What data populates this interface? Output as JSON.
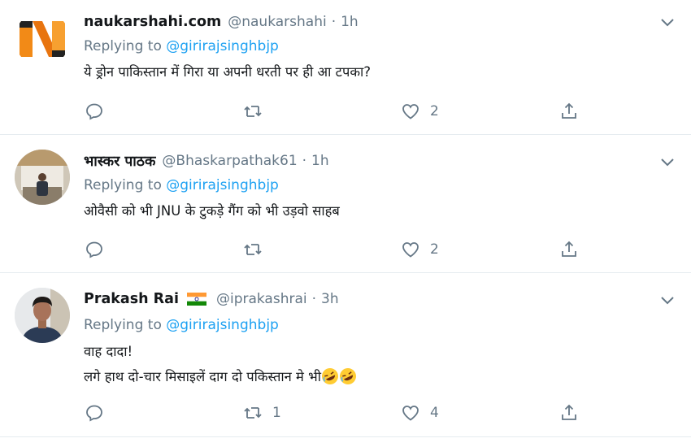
{
  "colors": {
    "link": "#1da1f2",
    "muted": "#657786",
    "text": "#14171a",
    "divider": "#e6ecf0"
  },
  "tweets": [
    {
      "name": "naukarshahi.com",
      "handle": "@naukarshahi",
      "separator": "·",
      "time": "1h",
      "replying_prefix": "Replying to",
      "replying_to": "@girirajsinghbjp",
      "lines": [
        "ये ड्रोन पाकिस्तान में गिरा या अपनी धरती पर ही आ टपका?"
      ],
      "reply_count": "",
      "retweet_count": "",
      "like_count": "2",
      "avatar": "naukarshahi-logo"
    },
    {
      "name": "भास्कर पाठक",
      "handle": "@Bhaskarpathak61",
      "separator": "·",
      "time": "1h",
      "replying_prefix": "Replying to",
      "replying_to": "@girirajsinghbjp",
      "lines": [
        "ओवैसी को भी JNU के टुकड़े गैंग को भी उड़वो साहब"
      ],
      "reply_count": "",
      "retweet_count": "",
      "like_count": "2",
      "avatar": "person-photo"
    },
    {
      "name": "Prakash Rai",
      "handle": "@iprakashrai",
      "separator": "·",
      "time": "3h",
      "replying_prefix": "Replying to",
      "replying_to": "@girirajsinghbjp",
      "lines": [
        "वाह दादा!",
        "लगे हाथ दो-चार मिसाइलें दाग दो पकिस्तान मे भी"
      ],
      "reply_count": "",
      "retweet_count": "1",
      "like_count": "4",
      "avatar": "person-photo",
      "name_badge": "india-flag-icon",
      "trailing_emoji": "rolling-laughing-emoji"
    }
  ]
}
